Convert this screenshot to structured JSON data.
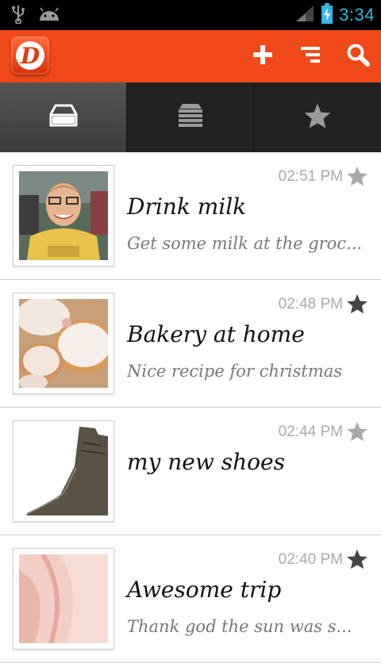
{
  "status_bar": {
    "time": "3:34",
    "icons": [
      "usb-icon",
      "android-icon",
      "signal-icon",
      "battery-charging-icon"
    ]
  },
  "action_bar": {
    "logo_letter": "D",
    "buttons": [
      "add-icon",
      "sort-icon",
      "search-icon"
    ],
    "color": "#ef4919"
  },
  "tabs": [
    {
      "icon": "inbox-icon",
      "active": true
    },
    {
      "icon": "stack-icon",
      "active": false
    },
    {
      "icon": "star-icon",
      "active": false
    }
  ],
  "notes": [
    {
      "time": "02:51 PM",
      "title": "Drink milk",
      "description": "Get some milk at the groc...",
      "starred": false,
      "thumbnail": "person-photo"
    },
    {
      "time": "02:48 PM",
      "title": "Bakery at home",
      "description": "Nice recipe for christmas",
      "starred": true,
      "thumbnail": "pastry-photo"
    },
    {
      "time": "02:44 PM",
      "title": "my new shoes",
      "description": "",
      "starred": false,
      "thumbnail": "shoe-photo"
    },
    {
      "time": "02:40 PM",
      "title": "Awesome trip",
      "description": "Thank god the sun was s...",
      "starred": true,
      "thumbnail": "canyon-photo"
    }
  ]
}
